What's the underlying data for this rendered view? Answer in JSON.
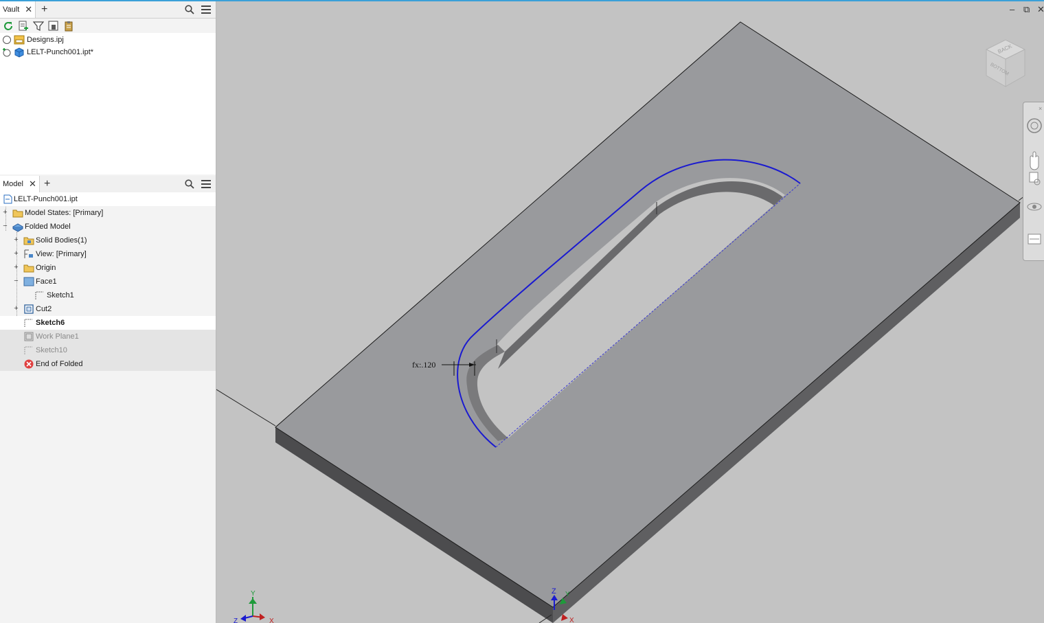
{
  "vault_panel": {
    "tab_label": "Vault",
    "files": [
      {
        "name": "Designs.ipj"
      },
      {
        "name": "LELT-Punch001.ipt*"
      }
    ]
  },
  "model_panel": {
    "tab_label": "Model",
    "tree": [
      {
        "label": "LELT-Punch001.ipt"
      },
      {
        "label": "Model States: [Primary]"
      },
      {
        "label": "Folded Model"
      },
      {
        "label": "Solid Bodies(1)"
      },
      {
        "label": "View: [Primary]"
      },
      {
        "label": "Origin"
      },
      {
        "label": "Face1"
      },
      {
        "label": "Sketch1"
      },
      {
        "label": "Cut2"
      },
      {
        "label": "Sketch6"
      },
      {
        "label": "Work Plane1"
      },
      {
        "label": "Sketch10"
      },
      {
        "label": "End of Folded"
      }
    ]
  },
  "viewport": {
    "dimension_label": "fx:.120",
    "viewcube_faces": [
      "BACK",
      "BOTTOM"
    ],
    "triad_axes": [
      "Y",
      "X",
      "Z"
    ],
    "origin_axes": [
      "Z",
      "Y",
      "X"
    ]
  },
  "colors": {
    "accent": "#3aa0d8",
    "sketch_line": "#1a1ad0",
    "viewport_bg": "#c3c3c3",
    "plate_top": "#999a9d"
  }
}
